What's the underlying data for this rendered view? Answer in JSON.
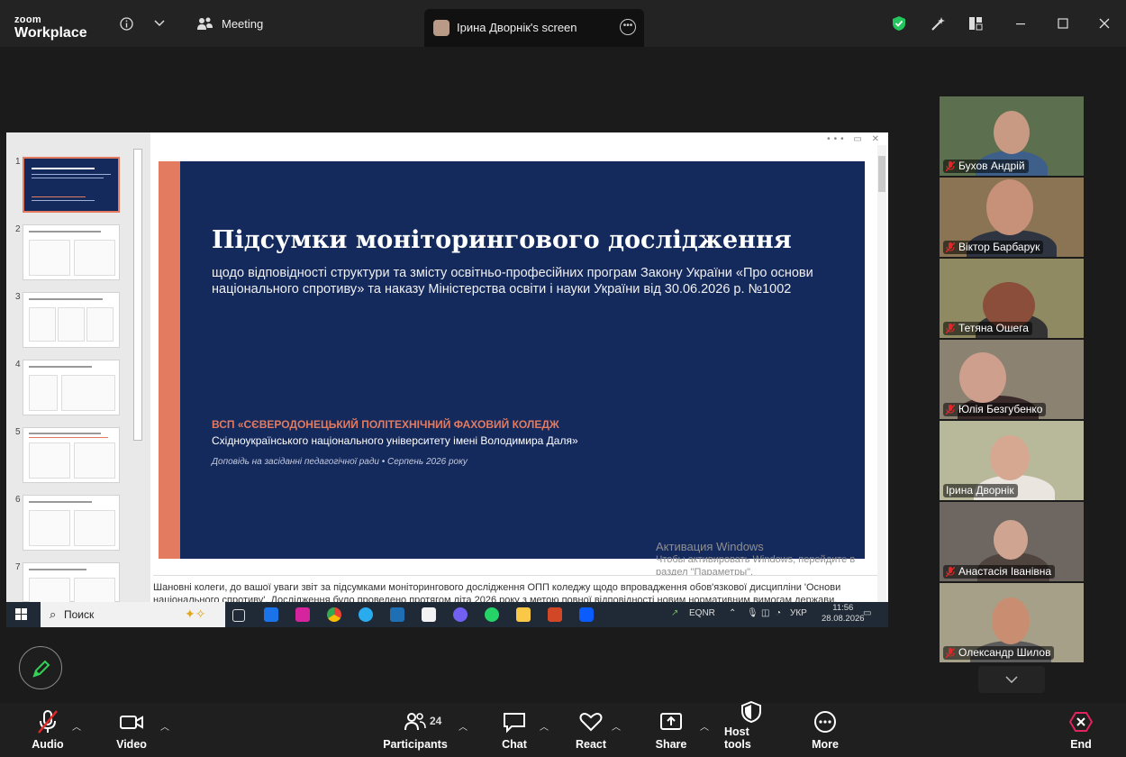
{
  "app": {
    "logo_line1": "zoom",
    "logo_line2": "Workplace",
    "meeting_label": "Meeting",
    "screen_tab_label": "Ірина Дворнік's screen"
  },
  "slide": {
    "title": "Підсумки моніторингового дослідження",
    "subtitle": "щодо відповідності структури та змісту освітньо-професійних програм Закону України «Про основи національного спротиву» та наказу Міністерства освіти і науки України від 30.06.2026 р. №1002",
    "org": "ВСП «СЄВЕРОДОНЕЦЬКИЙ ПОЛІТЕХНІЧНИЙ ФАХОВИЙ КОЛЕДЖ",
    "org2": "Східноукраїнського національного університету імені Володимира Даля»",
    "report": "Доповідь на засіданні педагогічної ради • Серпень 2026 року",
    "notes": "Шановні колеги, до вашої уваги звіт за підсумками моніторингового дослідження ОПП коледжу щодо впровадження обов'язкової дисципліни 'Основи національного спротиву'. Дослідження було проведено протягом літа 2026 року з метою повної відповідності новим нормативним вимогам держави."
  },
  "thumbnails": [
    {
      "num": "1"
    },
    {
      "num": "2"
    },
    {
      "num": "3"
    },
    {
      "num": "4"
    },
    {
      "num": "5"
    },
    {
      "num": "6"
    },
    {
      "num": "7"
    }
  ],
  "activation": {
    "title": "Активация Windows",
    "text": "Чтобы активировать Windows, перейдите в раздел \"Параметры\"."
  },
  "taskbar": {
    "search": "Поиск",
    "stock": "EQNR",
    "lang": "УКР",
    "time": "11:56",
    "date": "28.08.2026"
  },
  "participants_tiles": [
    {
      "name": "Бухов Андрій",
      "bg": "#5c6f4e",
      "skin": "#c89a84",
      "shirt": "#3e5f8a"
    },
    {
      "name": "Віктор Барбарук",
      "bg": "#8a7454",
      "skin": "#c69079",
      "shirt": "#2f3540"
    },
    {
      "name": "Тетяна Ошега",
      "bg": "#8f8a62",
      "skin": "#c99176",
      "shirt": "#333"
    },
    {
      "name": "Юлія Безгубенко",
      "bg": "#8c8272",
      "skin": "#cf9f8e",
      "shirt": "#3a2a2a"
    },
    {
      "name": "Ірина Дворнік",
      "bg": "#b8b89a",
      "skin": "#d7a891",
      "shirt": "#eae6df"
    },
    {
      "name": "Анастасія Іванівна",
      "bg": "#6e6660",
      "skin": "#cfa592",
      "shirt": "#50443e"
    },
    {
      "name": "Олександр Шилов",
      "bg": "#a6a088",
      "skin": "#c98e72",
      "shirt": "#5b5b5b"
    }
  ],
  "toolbar": {
    "audio": "Audio",
    "video": "Video",
    "participants": "Participants",
    "participants_count": "24",
    "chat": "Chat",
    "react": "React",
    "share": "Share",
    "host_tools": "Host tools",
    "more": "More",
    "end": "End"
  },
  "colors": {
    "accent": "#e37b60",
    "slide_bg": "#14295c",
    "active_speaker": "#2ec27e",
    "end": "#e0245e"
  }
}
